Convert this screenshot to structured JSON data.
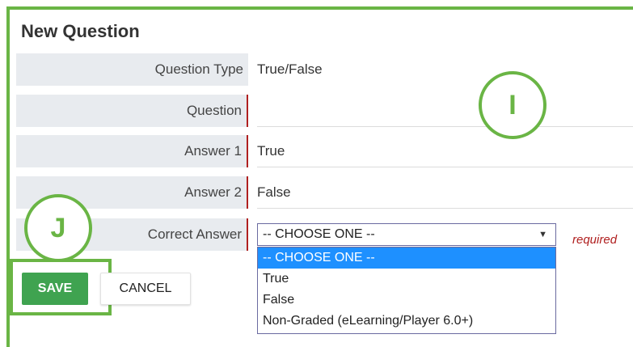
{
  "form": {
    "title": "New Question",
    "fields": {
      "question_type": {
        "label": "Question Type",
        "value": "True/False"
      },
      "question": {
        "label": "Question",
        "value": ""
      },
      "answer1": {
        "label": "Answer 1",
        "value": "True"
      },
      "answer2": {
        "label": "Answer 2",
        "value": "False"
      },
      "correct_answer": {
        "label": "Correct Answer",
        "selected": "-- CHOOSE ONE --",
        "required_note": "required",
        "options": [
          "-- CHOOSE ONE --",
          "True",
          "False",
          "Non-Graded (eLearning/Player 6.0+)"
        ]
      }
    },
    "buttons": {
      "save": "SAVE",
      "cancel": "CANCEL"
    }
  },
  "callouts": {
    "i": "I",
    "j": "J"
  },
  "colors": {
    "highlight_green": "#6ab545",
    "save_green": "#3fa350",
    "required_red": "#b02020",
    "label_bg": "#e8ebef",
    "dropdown_highlight": "#1e90ff"
  }
}
